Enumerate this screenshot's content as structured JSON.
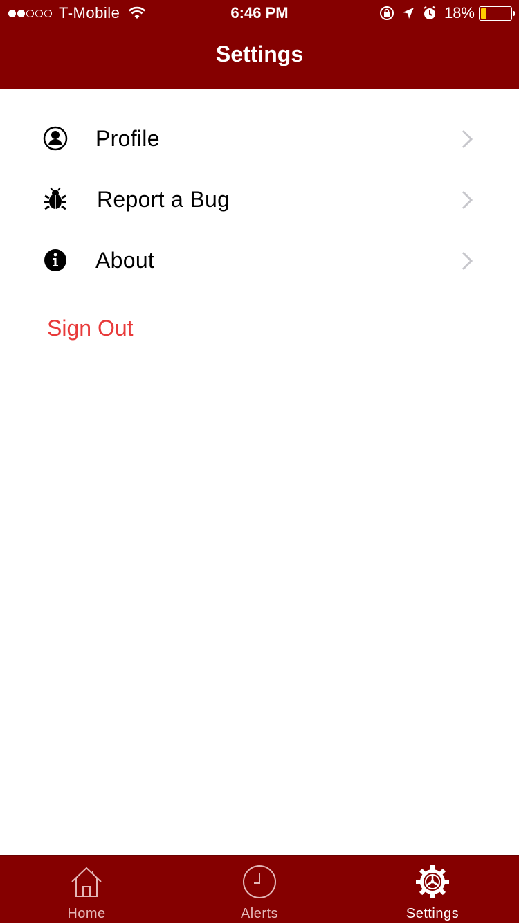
{
  "status_bar": {
    "carrier": "T-Mobile",
    "time": "6:46 PM",
    "battery_percent": "18%",
    "battery_level": 0.18,
    "signal_bars": 2,
    "signal_total": 5
  },
  "header": {
    "title": "Settings"
  },
  "menu": {
    "items": [
      {
        "label": "Profile",
        "icon": "profile-icon"
      },
      {
        "label": "Report a Bug",
        "icon": "bug-icon"
      },
      {
        "label": "About",
        "icon": "info-icon"
      }
    ],
    "sign_out_label": "Sign Out"
  },
  "tabbar": {
    "tabs": [
      {
        "label": "Home",
        "icon": "home-icon",
        "active": false
      },
      {
        "label": "Alerts",
        "icon": "clock-icon",
        "active": false
      },
      {
        "label": "Settings",
        "icon": "gear-icon",
        "active": true
      }
    ]
  },
  "colors": {
    "brand": "#850000",
    "sign_out": "#e83a3a",
    "chevron": "#c7c7cc",
    "battery_fill": "#ffcc00"
  }
}
